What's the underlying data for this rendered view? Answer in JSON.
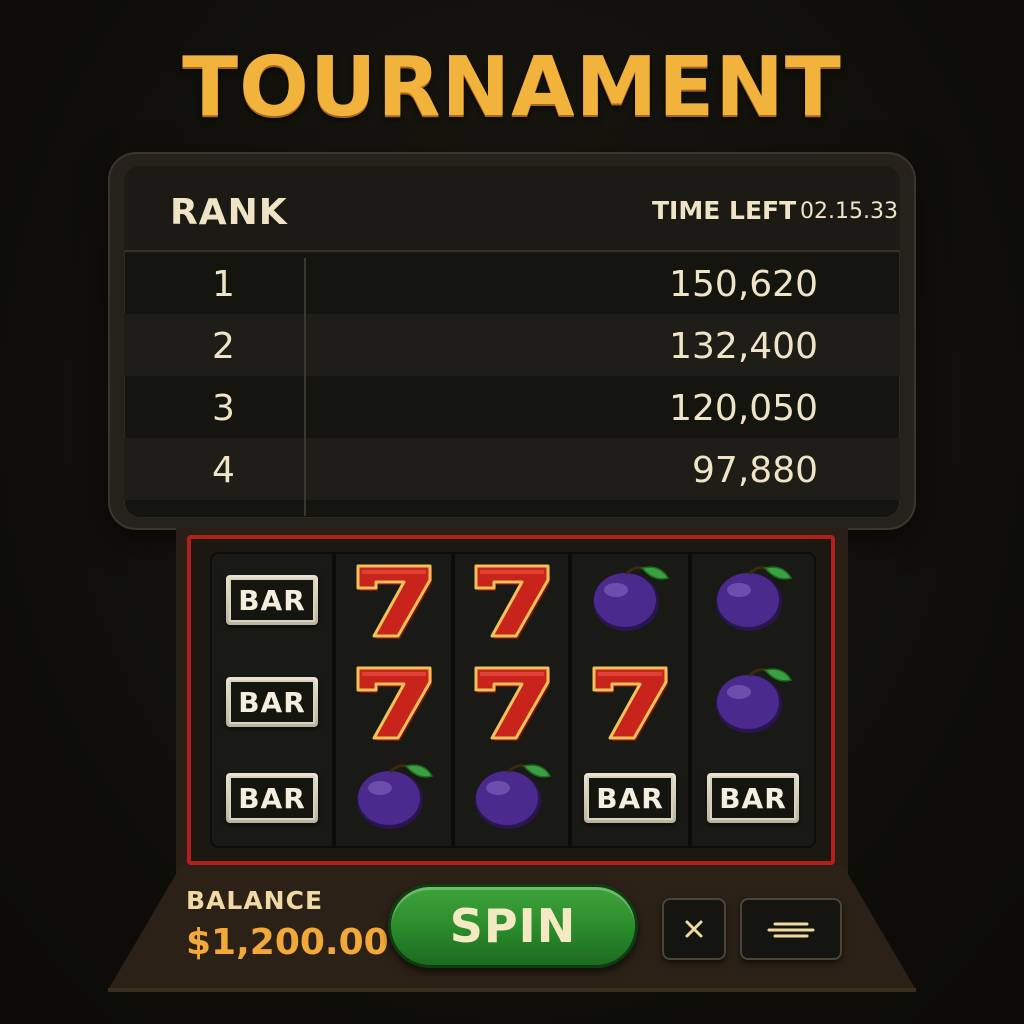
{
  "title": "TOURNAMENT",
  "leaderboard": {
    "rank_label": "RANK",
    "time_left_label": "TIME LEFT",
    "time_left_value": "02.15.33",
    "rows": [
      {
        "rank": "1",
        "score": "150,620"
      },
      {
        "rank": "2",
        "score": "132,400"
      },
      {
        "rank": "3",
        "score": "120,050"
      },
      {
        "rank": "4",
        "score": "97,880"
      }
    ]
  },
  "reels": {
    "symbol_text": {
      "bar": "BAR"
    },
    "grid": [
      [
        "bar",
        "seven",
        "seven",
        "plum",
        "plum"
      ],
      [
        "bar",
        "seven",
        "seven",
        "seven",
        "plum"
      ],
      [
        "bar",
        "plum",
        "plum",
        "bar",
        "bar"
      ]
    ],
    "frame_color": "#b3201c"
  },
  "controls": {
    "balance_label": "BALANCE",
    "balance_value": "$1,200.00",
    "spin_label": "SPIN",
    "close_icon": "close-icon",
    "menu_icon": "menu-icon"
  },
  "colors": {
    "title": "#f2b33d",
    "balance": "#f2a93a",
    "spin": "#2a8a2b",
    "seven": "#c8241c",
    "plum": "#4a2a8c"
  }
}
